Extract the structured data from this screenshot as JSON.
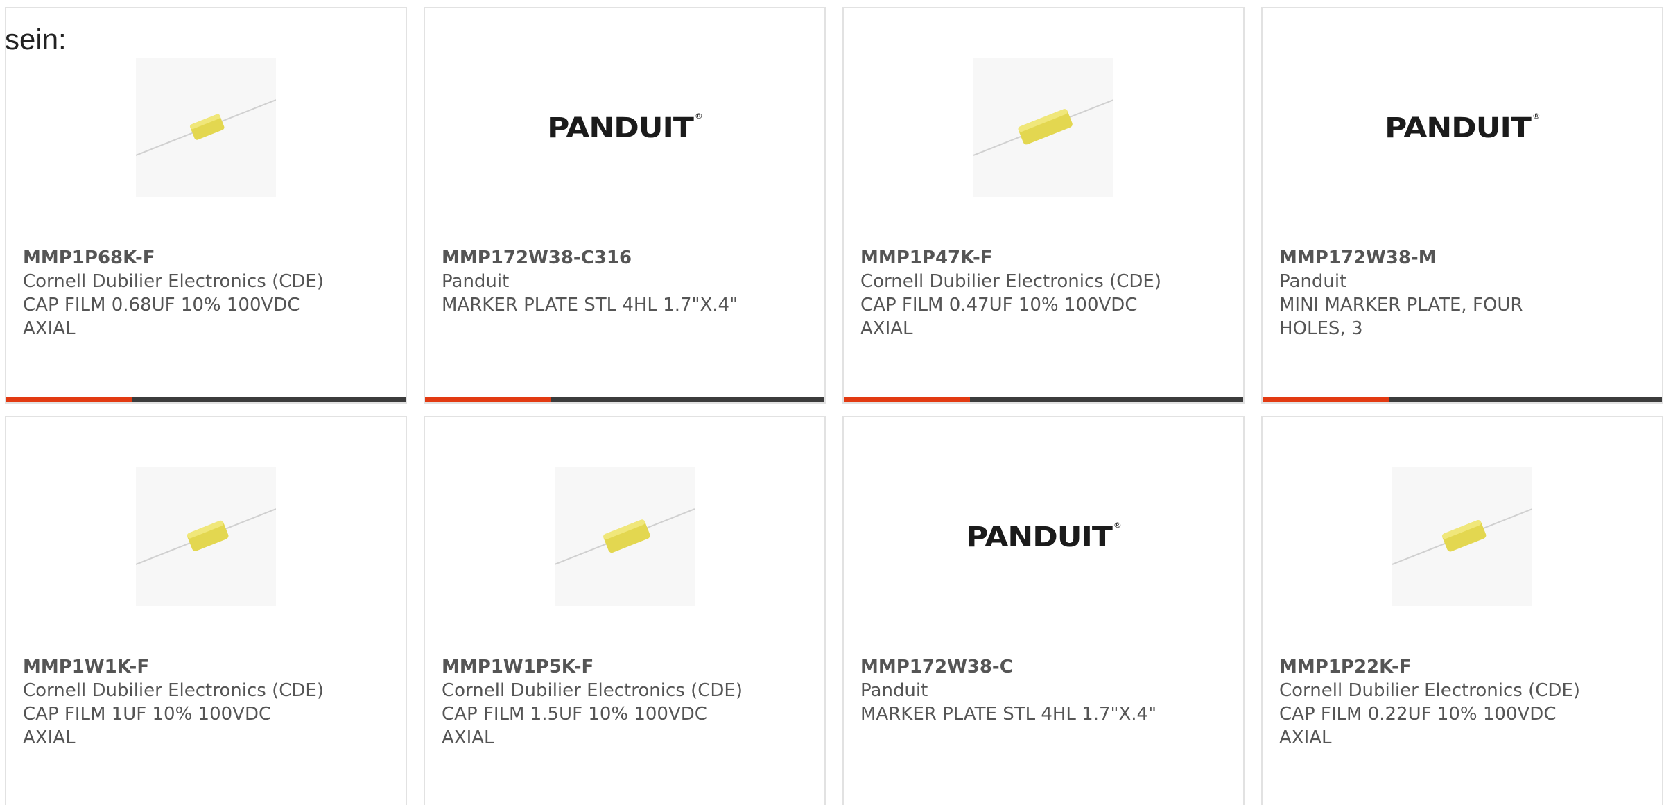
{
  "prefix_text": "sein:",
  "colors": {
    "accent": "#e23a12",
    "bar": "#3c3c3c",
    "text": "#555555",
    "border": "#e2e2e2",
    "capacitor": "#e3d750"
  },
  "products": [
    {
      "part_number": "MMP1P68K-F",
      "manufacturer": "Cornell Dubilier Electronics (CDE)",
      "description": "CAP FILM 0.68UF 10% 100VDC AXIAL",
      "image": "capacitor-image"
    },
    {
      "part_number": "MMP172W38-C316",
      "manufacturer": "Panduit",
      "description": "MARKER PLATE STL 4HL 1.7\"X.4\"",
      "image": "panduit-logo",
      "logo_text": "PANDUIT"
    },
    {
      "part_number": "MMP1P47K-F",
      "manufacturer": "Cornell Dubilier Electronics (CDE)",
      "description": "CAP FILM 0.47UF 10% 100VDC AXIAL",
      "image": "capacitor-image"
    },
    {
      "part_number": "MMP172W38-M",
      "manufacturer": "Panduit",
      "description": "MINI MARKER PLATE, FOUR HOLES, 3",
      "image": "panduit-logo",
      "logo_text": "PANDUIT"
    },
    {
      "part_number": "MMP1W1K-F",
      "manufacturer": "Cornell Dubilier Electronics (CDE)",
      "description": "CAP FILM 1UF 10% 100VDC AXIAL",
      "image": "capacitor-image"
    },
    {
      "part_number": "MMP1W1P5K-F",
      "manufacturer": "Cornell Dubilier Electronics (CDE)",
      "description": "CAP FILM 1.5UF 10% 100VDC AXIAL",
      "image": "capacitor-image"
    },
    {
      "part_number": "MMP172W38-C",
      "manufacturer": "Panduit",
      "description": "MARKER PLATE STL 4HL 1.7\"X.4\"",
      "image": "panduit-logo",
      "logo_text": "PANDUIT"
    },
    {
      "part_number": "MMP1P22K-F",
      "manufacturer": "Cornell Dubilier Electronics (CDE)",
      "description": "CAP FILM 0.22UF 10% 100VDC AXIAL",
      "image": "capacitor-image"
    }
  ]
}
